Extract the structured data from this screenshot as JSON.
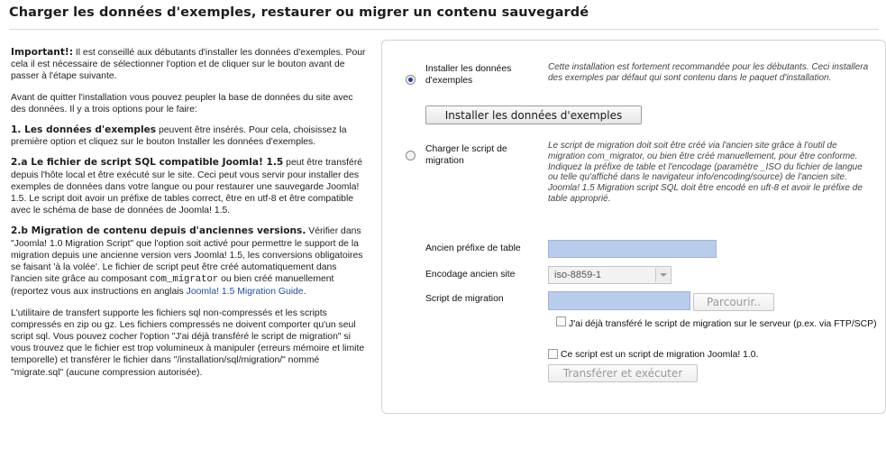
{
  "page": {
    "title": "Charger les données d'exemples, restaurer ou migrer un contenu sauvegardé"
  },
  "intro": {
    "p1_bold": "Important!:",
    "p1_text": " Il est conseillé aux débutants d'installer les données d'exemples. Pour cela il est nécessaire de sélectionner l'option et de cliquer sur le bouton avant de passer à l'étape suivante.",
    "p2_text": "Avant de quitter l'installation vous pouvez peupler la base de données du site avec des données. Il y a trois options pour le faire:",
    "p3_bold": "1. Les données d'exemples",
    "p3_text": " peuvent être insérés. Pour cela, choisissez la première option et cliquez sur le bouton Installer les données d'exemples.",
    "p4_bold": "2.a Le fichier de script SQL compatible Joomla! 1.5",
    "p4_text": " peut être transféré depuis l'hôte local et être exécuté sur le site. Ceci peut vous servir pour installer des exemples de données dans votre langue ou pour restaurer une sauvegarde Joomla! 1.5. Le script doit avoir un préfixe de tables correct, être en utf-8 et être compatible avec le schéma de base de données de Joomla! 1.5.",
    "p5_bold": "2.b Migration de contenu depuis d'anciennes versions.",
    "p5_text_a": " Vérifier dans \"Joomla! 1.0 Migration Script\" que l'option soit activé pour permettre le support de la migration depuis une ancienne version vers Joomla! 1.5, les conversions obligatoires se faisant 'à la volée'. Le fichier de script peut être créé automatiquement dans l'ancien site grâce au composant ",
    "p5_code": "com_migrator",
    "p5_text_b": " ou bien créé manuellement (reportez vous aux instructions en anglais ",
    "p5_link": "Joomla! 1.5 Migration Guide",
    "p5_text_c": ".",
    "p6_text": "L'utilitaire de transfert supporte les fichiers sql non-compressés et les scripts compressés en zip ou gz. Les fichiers compressés ne doivent comporter qu'un seul script sql. Vous pouvez cocher l'option \"J'ai déjà transféré le script de migration\" si vous trouvez que le fichier est trop volumineux à manipuler (erreurs mémoire et limite temporelle) et transférer le fichier dans \"/installation/sql/migration/\" nommé \"migrate.sql\" (aucune compression autorisée)."
  },
  "options": {
    "sample": {
      "label": "Installer les données d'exemples",
      "description": "Cette installation est fortement recommandée pour les débutants. Ceci installera des exemples par défaut qui sont contenu dans le paquet d'installation.",
      "button": "Installer les données d'exemples",
      "selected": true
    },
    "migration": {
      "label": "Charger le script de migration",
      "description": "Le script de migration doit soit être créé via l'ancien site grâce à l'outil de migration com_migrator, ou bien être créé manuellement, pour être conforme. Indiquez la préfixe de table et l'encodage (paramètre _ISO du fichier de langue ou telle qu'affiché dans le navigateur info/encoding/source) de l'ancien site. Joomla! 1.5 Migration script SQL doit être encodé en uft-8 et avoir le préfixe de table approprié.",
      "selected": false
    }
  },
  "form": {
    "prefix_label": "Ancien préfixe de table",
    "prefix_value": "",
    "encoding_label": "Encodage ancien site",
    "encoding_value": "iso-8859-1",
    "script_label": "Script de migration",
    "browse_button": "Parcourir..",
    "cb1_label": "J'ai déjà transféré le script de migration sur le serveur (p.ex. via FTP/SCP)",
    "cb2_label": "Ce script est un script de migration Joomla! 1.0.",
    "execute_button": "Transférer et exécuter"
  },
  "colors": {
    "input_fill": "#b8ccec",
    "link": "#1d4fa3"
  }
}
